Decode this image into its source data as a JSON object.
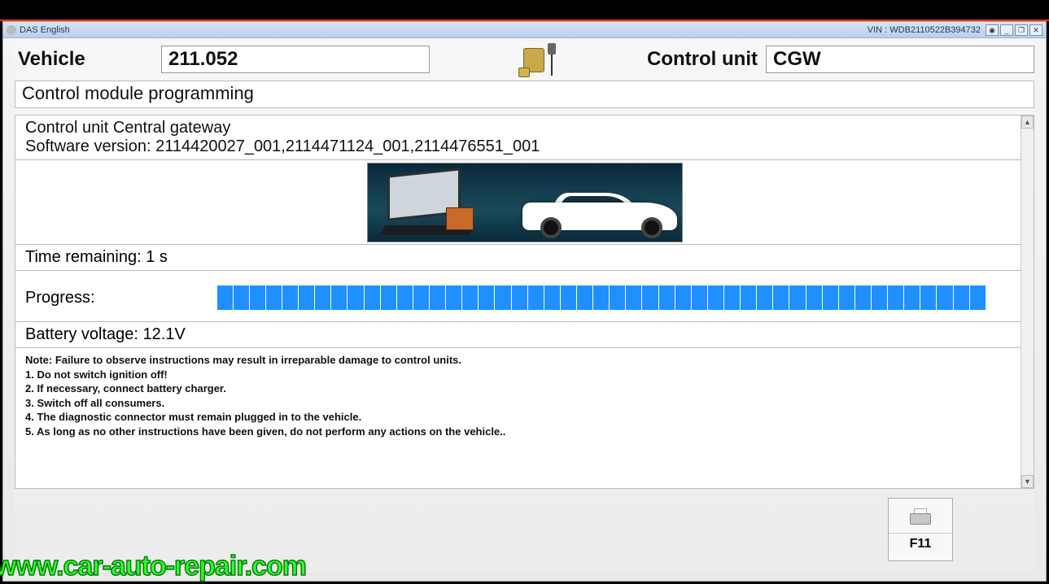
{
  "titlebar": {
    "app_name": "DAS English",
    "vin_label": "VIN : WDB2110522B394732"
  },
  "header": {
    "vehicle_label": "Vehicle",
    "vehicle_value": "211.052",
    "control_unit_label": "Control unit",
    "control_unit_value": "CGW"
  },
  "subtitle": "Control module programming",
  "info": {
    "line1": "Control unit Central gateway",
    "line2": "Software version: 2114420027_001,2114471124_001,2114476551_001"
  },
  "time_remaining": "Time remaining: 1 s",
  "progress": {
    "label": "Progress:",
    "percent": 100,
    "segments": 47
  },
  "battery": "Battery voltage: 12.1V",
  "notes": {
    "heading": "Note:  Failure to observe instructions may result in irreparable damage to control units.",
    "items": [
      "1. Do not switch ignition off!",
      "2. If necessary, connect battery charger.",
      "3. Switch off all consumers.",
      "4. The diagnostic connector must remain plugged in to the vehicle.",
      "5. As long as no other instructions have been given, do not perform any actions on the vehicle.."
    ]
  },
  "footer": {
    "f11": "F11"
  },
  "watermark": "www.car-auto-repair.com",
  "win_controls": {
    "min": "_",
    "max": "❐",
    "close": "✕",
    "help": "◉"
  }
}
